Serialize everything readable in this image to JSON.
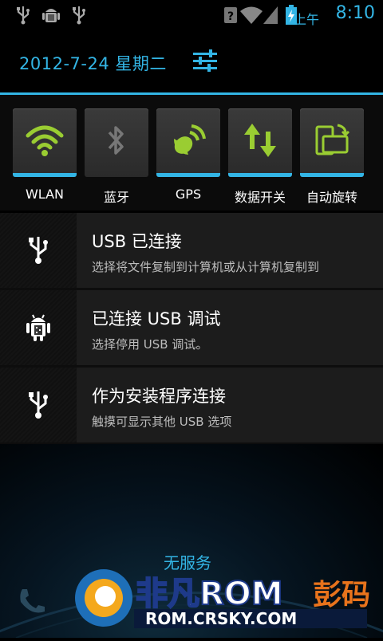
{
  "status_bar": {
    "icons_left": [
      "usb-icon",
      "android-debug-icon",
      "usb-icon"
    ],
    "icons_right": [
      "wifi-icon",
      "signal-icon",
      "battery-charging-icon"
    ],
    "ampm": "上午",
    "time": "8:10"
  },
  "header": {
    "date": "2012-7-24 星期二"
  },
  "toggles": [
    {
      "label": "WLAN",
      "icon": "wifi-icon",
      "on": true
    },
    {
      "label": "蓝牙",
      "icon": "bluetooth-icon",
      "on": false
    },
    {
      "label": "GPS",
      "icon": "gps-icon",
      "on": true
    },
    {
      "label": "数据开关",
      "icon": "data-transfer-icon",
      "on": true
    },
    {
      "label": "自动旋转",
      "icon": "auto-rotate-icon",
      "on": true
    }
  ],
  "notifications": [
    {
      "title": "USB 已连接",
      "text": "选择将文件复制到计算机或从计算机复制到",
      "icon": "usb-icon"
    },
    {
      "title": "已连接 USB 调试",
      "text": "选择停用 USB 调试。",
      "icon": "android-debug-icon"
    },
    {
      "title": "作为安装程序连接",
      "text": "触摸可显示其他 USB 选项",
      "icon": "usb-icon"
    }
  ],
  "lockscreen": {
    "no_service": "无服务"
  },
  "watermark": {
    "brand": "非凡ROM",
    "suffix": "彭码",
    "url": "ROM.CRSKY.COM"
  },
  "colors": {
    "accent": "#33b5e5",
    "toggle_on_icon": "#9acd32"
  }
}
